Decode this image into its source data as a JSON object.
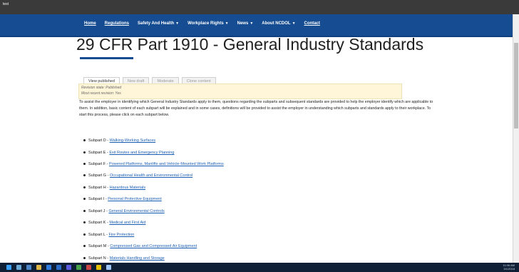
{
  "browser": {
    "title": "test"
  },
  "nav": {
    "items": [
      {
        "label": "Home",
        "underline": true,
        "dropdown": false
      },
      {
        "label": "Regulations",
        "underline": true,
        "dropdown": false
      },
      {
        "label": "Safety And Health",
        "underline": false,
        "dropdown": true
      },
      {
        "label": "Workplace Rights",
        "underline": false,
        "dropdown": true
      },
      {
        "label": "News",
        "underline": false,
        "dropdown": true
      },
      {
        "label": "About NCDOL",
        "underline": false,
        "dropdown": true
      },
      {
        "label": "Contact",
        "underline": true,
        "dropdown": false
      }
    ]
  },
  "page": {
    "title": "29 CFR Part 1910 - General Industry Standards",
    "tabs": [
      "View published",
      "New draft",
      "Moderate",
      "Clone content"
    ],
    "revision": {
      "state_label": "Revision state: Published",
      "recent_label": "Most recent revision: Yes"
    },
    "intro": "To assist the employer in identifying which General Industry Standards apply to them, questions regarding the subparts and subsequent standards are provided to help the employer identify which are applicable to them. In addition, basic content of each subpart will be explained and in some cases, definitions will be provided to assist the employer in understanding which subparts and standards apply to their workplace. To start this process, please click on each subpart below.",
    "subparts": [
      {
        "label": "Subpart D - ",
        "link": "Walking-Working Surfaces"
      },
      {
        "label": "Subpart E - ",
        "link": "Exit Routes and Emergency Planning"
      },
      {
        "label": "Subpart F - ",
        "link": "Powered Platforms, Manlifts and Vehicle-Mounted Work Platforms"
      },
      {
        "label": "Subpart G - ",
        "link": "Occupational Health and Environmental Control"
      },
      {
        "label": "Subpart H - ",
        "link": "Hazardous Materials"
      },
      {
        "label": "Subpart I - ",
        "link": "Personal Protective Equipment"
      },
      {
        "label": "Subpart J - ",
        "link": "General Environmental Controls"
      },
      {
        "label": "Subpart K - ",
        "link": "Medical and First Aid"
      },
      {
        "label": "Subpart L - ",
        "link": "Fire Protection"
      },
      {
        "label": "Subpart M - ",
        "link": "Compressed Gas and Compressed Air Equipment"
      },
      {
        "label": "Subpart N - ",
        "link": "Materials Handling and Storage"
      }
    ]
  },
  "taskbar": {
    "clock_time": "11:06 AM",
    "clock_date": "3/1/2018"
  },
  "colors": {
    "nav": "#154c92",
    "link": "#1a5fb4"
  }
}
